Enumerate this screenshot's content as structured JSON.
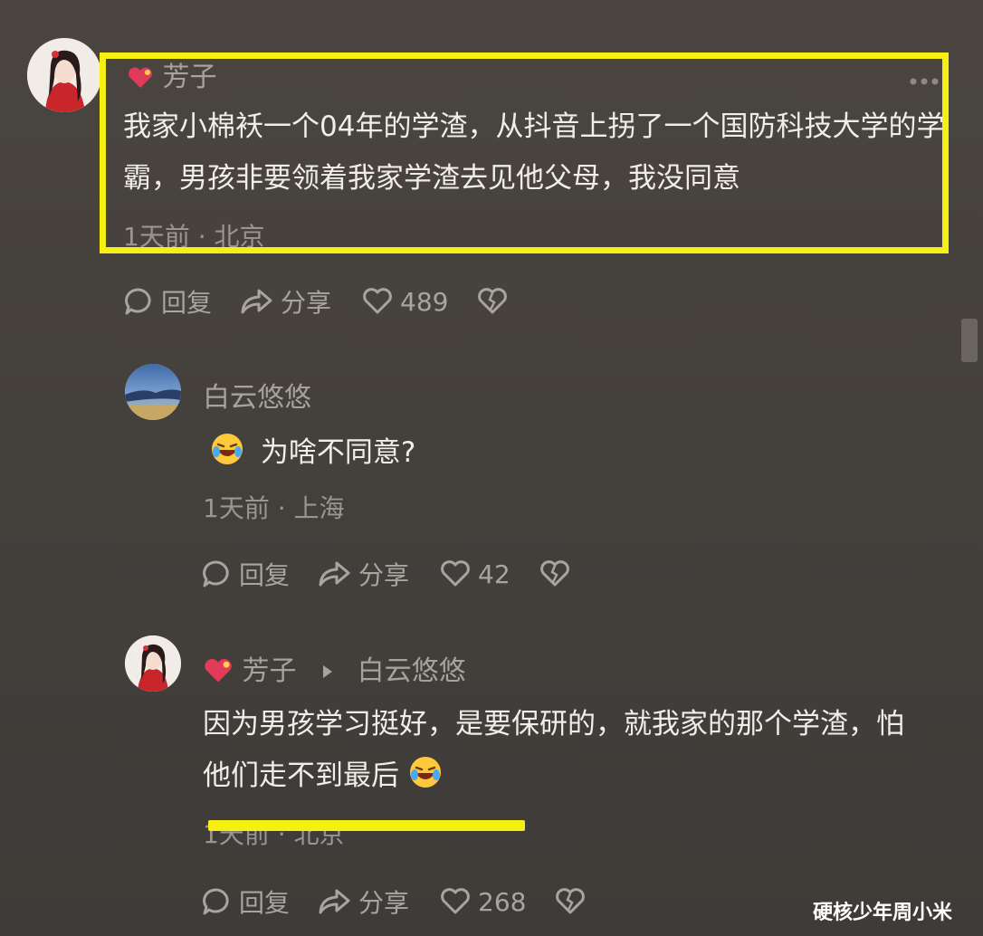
{
  "comments": [
    {
      "author": "芳子",
      "text": "我家小棉袄一个04年的学渣，从抖音上拐了一个国防科技大学的学霸，男孩非要领着我家学渣去见他父母，我没同意",
      "time": "1天前",
      "location": "北京",
      "reply_label": "回复",
      "share_label": "分享",
      "likes": "489"
    },
    {
      "author": "白云悠悠",
      "text": "为啥不同意?",
      "time": "1天前",
      "location": "上海",
      "reply_label": "回复",
      "share_label": "分享",
      "likes": "42"
    },
    {
      "author": "芳子",
      "reply_to": "白云悠悠",
      "text": "因为男孩学习挺好，是要保研的，就我家的那个学渣，怕他们走不到最后",
      "time": "1天前",
      "location": "北京",
      "reply_label": "回复",
      "share_label": "分享",
      "likes": "268"
    }
  ],
  "watermark": "硬核少年周小米",
  "colors": {
    "highlight": "#f5f00f",
    "background": "#45413d"
  },
  "icons": [
    "more-icon",
    "comment-icon",
    "share-icon",
    "heart-icon",
    "dislike-icon",
    "laugh-emoji-icon",
    "heart-badge-icon",
    "caret-right-icon"
  ]
}
